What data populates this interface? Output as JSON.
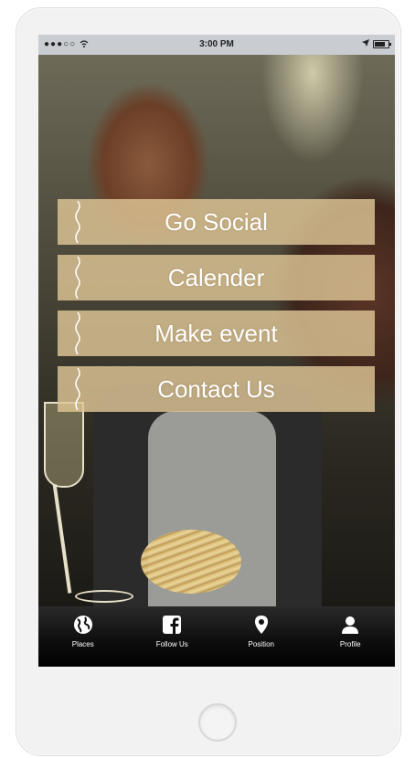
{
  "status_bar": {
    "signal": "●●●○○",
    "time": "3:00 PM"
  },
  "menu": {
    "items": [
      {
        "label": "Go Social"
      },
      {
        "label": "Calender"
      },
      {
        "label": "Make event"
      },
      {
        "label": "Contact Us"
      }
    ]
  },
  "tabbar": {
    "items": [
      {
        "label": "Places",
        "icon": "globe-icon"
      },
      {
        "label": "Follow Us",
        "icon": "facebook-icon"
      },
      {
        "label": "Position",
        "icon": "location-pin-icon"
      },
      {
        "label": "Profile",
        "icon": "user-icon"
      }
    ]
  },
  "colors": {
    "menu_button_bg": "#dec696",
    "tabbar_bg": "#000000",
    "status_bar_bg": "#c9ccd0"
  }
}
